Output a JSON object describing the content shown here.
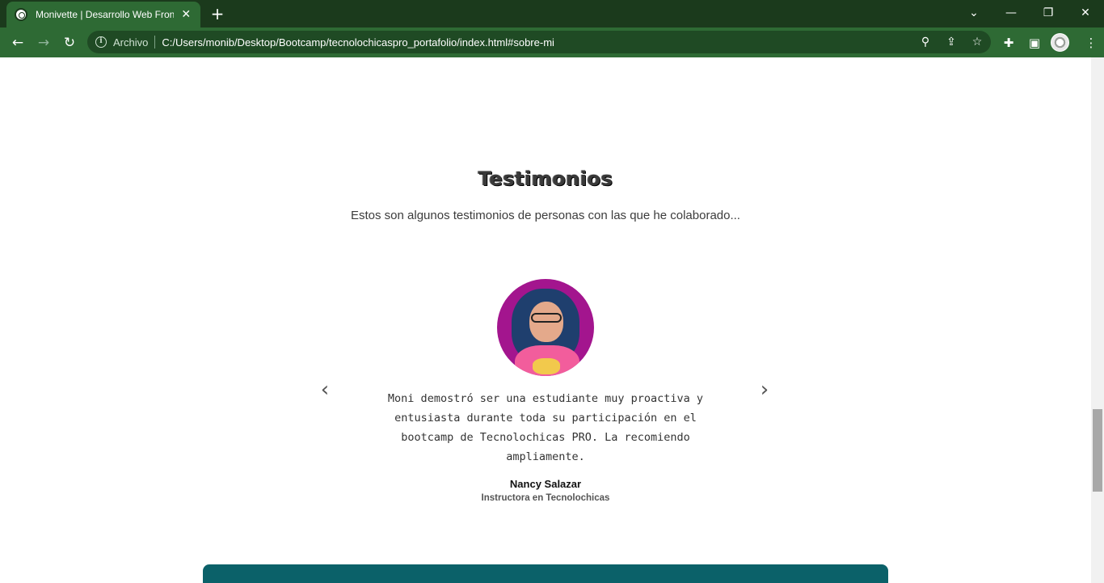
{
  "browser": {
    "tab_title": "Monivette | Desarrollo Web Front",
    "tab_close": "✕",
    "new_tab": "+",
    "scheme_label": "Archivo",
    "url": "C:/Users/monib/Desktop/Bootcamp/tecnolochicaspro_portafolio/index.html#sobre-mi",
    "icons": [
      "back-icon",
      "forward-icon",
      "reload-icon",
      "info-icon",
      "zoom-icon",
      "share-icon",
      "star-icon",
      "extensions-icon",
      "side-panel-icon",
      "profile-avatar"
    ],
    "window_controls": [
      "chevron-down-icon",
      "minimize-icon",
      "restore-icon",
      "close-icon"
    ]
  },
  "testimonials": {
    "title": "Testimonios",
    "subtitle": "Estos son algunos testimonios de personas con las que he colaborado...",
    "items": [
      {
        "quote": "Moni demostró ser una estudiante muy proactiva y entusiasta durante toda su participación en el bootcamp de Tecnolochicas PRO. La recomiendo ampliamente.",
        "author": "Nancy Salazar",
        "role": "Instructora en Tecnolochicas"
      }
    ]
  },
  "colors": {
    "chrome_dark": "#1b3a1c",
    "chrome_toolbar": "#2e6a34",
    "avatar_bg": "#a3158e",
    "next_section_bg": "#0b6169"
  }
}
